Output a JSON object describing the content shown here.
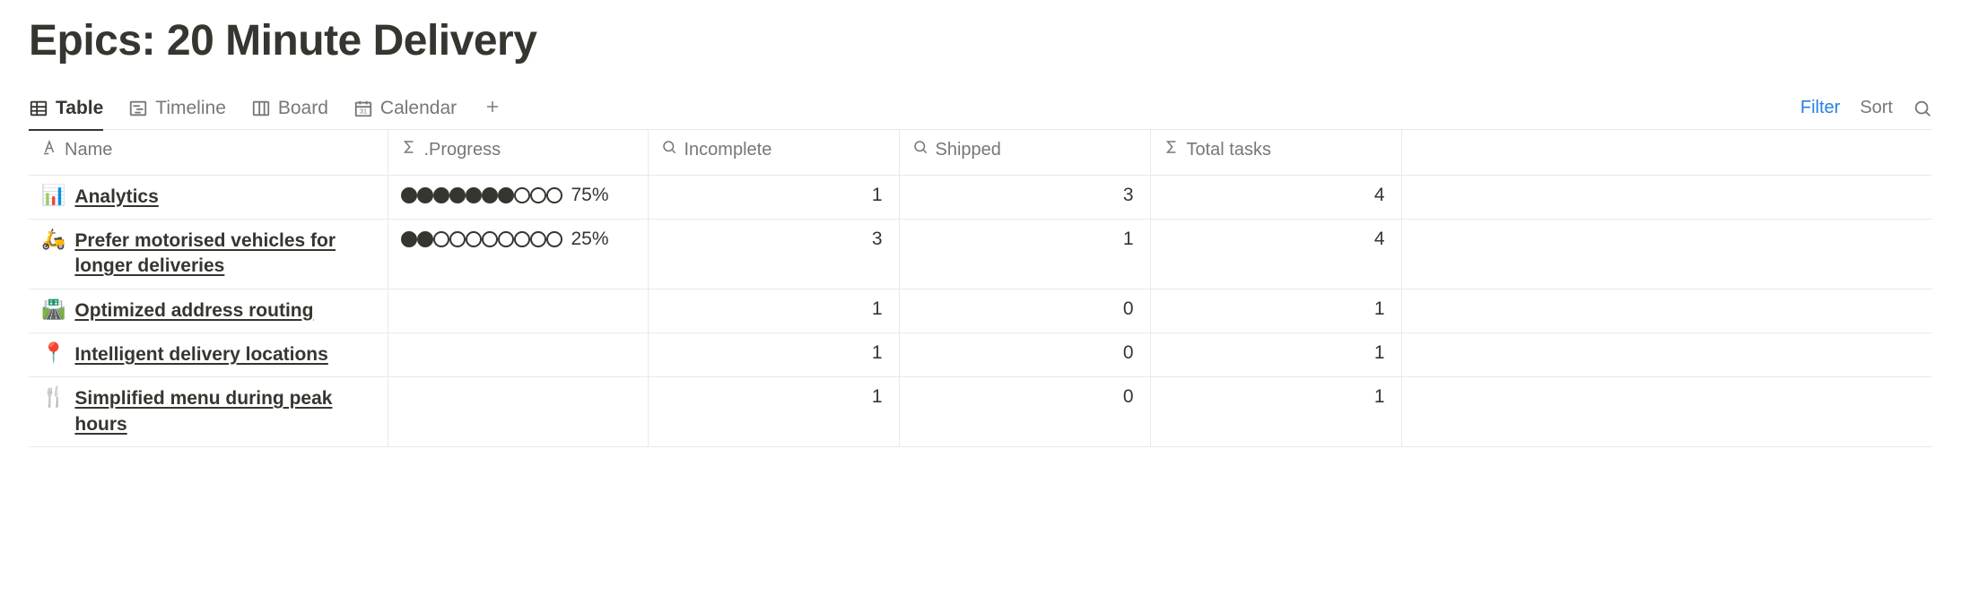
{
  "page_title": "Epics: 20 Minute Delivery",
  "views": [
    {
      "id": "table",
      "label": "Table",
      "active": true
    },
    {
      "id": "timeline",
      "label": "Timeline",
      "active": false
    },
    {
      "id": "board",
      "label": "Board",
      "active": false
    },
    {
      "id": "calendar",
      "label": "Calendar",
      "active": false
    }
  ],
  "toolbar": {
    "filter_label": "Filter",
    "sort_label": "Sort"
  },
  "columns": {
    "name": {
      "label": "Name"
    },
    "progress": {
      "label": ".Progress"
    },
    "incomplete": {
      "label": "Incomplete"
    },
    "shipped": {
      "label": "Shipped"
    },
    "total": {
      "label": "Total tasks"
    }
  },
  "rows": [
    {
      "emoji": "📊",
      "name": "Analytics",
      "progress": {
        "filled": 7,
        "total": 10,
        "label": "75%"
      },
      "incomplete": 1,
      "shipped": 3,
      "total_tasks": 4
    },
    {
      "emoji": "🛵",
      "name": "Prefer motorised vehicles for longer deliveries",
      "progress": {
        "filled": 2,
        "total": 10,
        "label": "25%"
      },
      "incomplete": 3,
      "shipped": 1,
      "total_tasks": 4
    },
    {
      "emoji": "🛣️",
      "name": "Optimized address routing",
      "progress": null,
      "incomplete": 1,
      "shipped": 0,
      "total_tasks": 1
    },
    {
      "emoji": "📍",
      "name": "Intelligent delivery locations",
      "progress": null,
      "incomplete": 1,
      "shipped": 0,
      "total_tasks": 1
    },
    {
      "emoji": "🍴",
      "name": "Simplified menu during peak hours",
      "progress": null,
      "incomplete": 1,
      "shipped": 0,
      "total_tasks": 1
    }
  ]
}
